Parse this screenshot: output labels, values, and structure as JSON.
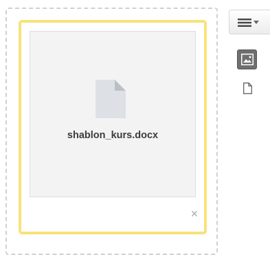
{
  "file": {
    "name": "shablon_kurs.docx",
    "remove_label": "×"
  },
  "toolbar": {
    "menu_icon": "hamburger-menu-icon",
    "views": [
      {
        "name": "image-view",
        "icon": "image-icon",
        "active": true
      },
      {
        "name": "file-view",
        "icon": "file-icon",
        "active": false
      }
    ]
  },
  "colors": {
    "card_border": "#f8e27a",
    "active_view_bg": "#6f6f6f"
  }
}
